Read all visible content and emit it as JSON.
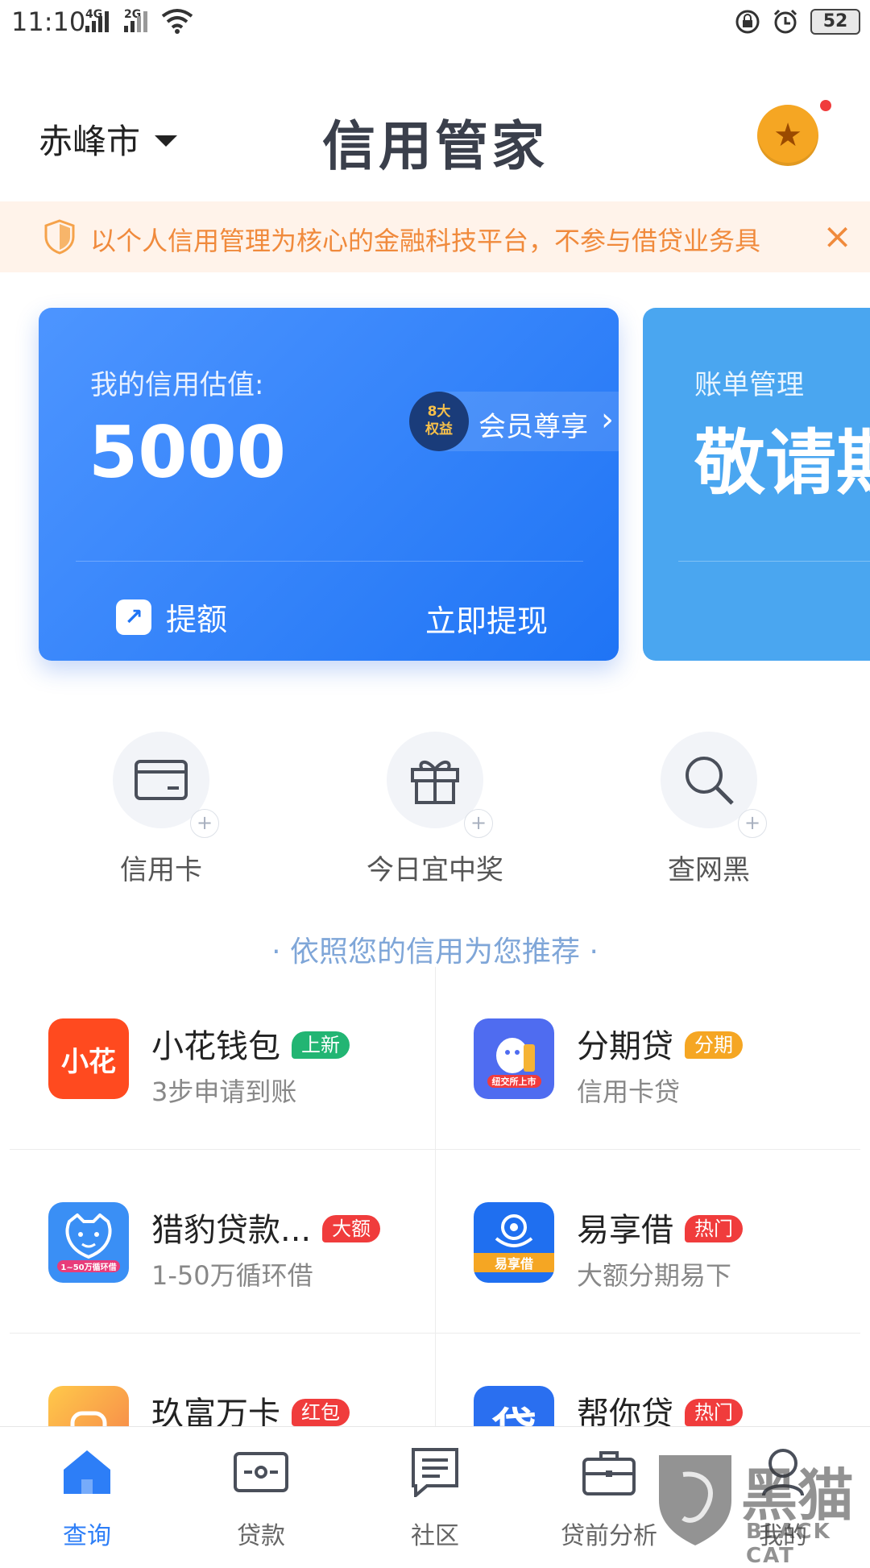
{
  "status_bar": {
    "time": "11:10",
    "net1": "4G",
    "net2": "2G",
    "battery": "52"
  },
  "header": {
    "city": "赤峰市",
    "brand": "信用管家"
  },
  "notice": {
    "text": "以个人信用管理为核心的金融科技平台，不参与借贷业务具",
    "close_symbol": "×"
  },
  "credit_card": {
    "label": "我的信用估值:",
    "value": "5000",
    "member_badge": [
      "8大",
      "权益"
    ],
    "member_text": "会员尊享",
    "raise_label": "提额",
    "withdraw_label": "立即提现"
  },
  "bill_card": {
    "label": "账单管理",
    "value": "敬请期待"
  },
  "shortcuts": [
    {
      "label": "信用卡",
      "icon": "credit-card-icon"
    },
    {
      "label": "今日宜中奖",
      "icon": "gift-icon"
    },
    {
      "label": "查网黑",
      "icon": "search-icon"
    }
  ],
  "recommend_title": "· 依照您的信用为您推荐 ·",
  "products": [
    {
      "name": "小花钱包",
      "tag": "上新",
      "tag_color": "#22b573",
      "subtitle": "3步申请到账",
      "logo_text": "小花",
      "logo_color": "#ff4a1f"
    },
    {
      "name": "分期贷",
      "tag": "分期",
      "tag_color": "#f5a623",
      "subtitle": "信用卡贷",
      "logo_text": "纽交所上市",
      "logo_color": "#4f6cf0"
    },
    {
      "name": "猎豹贷款...",
      "tag": "大额",
      "tag_color": "#f03c3c",
      "subtitle": "1-50万循环借",
      "logo_text": "1~50万循环借",
      "logo_color": "#3a8ff5"
    },
    {
      "name": "易享借",
      "tag": "热门",
      "tag_color": "#f03c3c",
      "subtitle": "大额分期易下",
      "logo_text": "易享借",
      "logo_color": "#1f6ff0"
    },
    {
      "name": "玖富万卡",
      "tag": "红包",
      "tag_color": "#f03c3c",
      "subtitle": "",
      "logo_text": "",
      "logo_color": "#f7a84a"
    },
    {
      "name": "帮你贷",
      "tag": "热门",
      "tag_color": "#f03c3c",
      "subtitle": "",
      "logo_text": "贷",
      "logo_color": "#2a6ff0"
    }
  ],
  "bottom_nav": [
    {
      "label": "查询",
      "icon": "home-icon",
      "active": true
    },
    {
      "label": "贷款",
      "icon": "loan-icon",
      "active": false
    },
    {
      "label": "社区",
      "icon": "community-icon",
      "active": false
    },
    {
      "label": "贷前分析",
      "icon": "briefcase-icon",
      "active": false
    },
    {
      "label": "我的",
      "icon": "profile-icon",
      "active": false
    }
  ],
  "watermark": {
    "text_cn": "黑猫",
    "text_en": "BLACK CAT"
  },
  "colors": {
    "primary": "#2d7ef7",
    "notice": "#f08a3c",
    "accent_red": "#f03c3c"
  }
}
